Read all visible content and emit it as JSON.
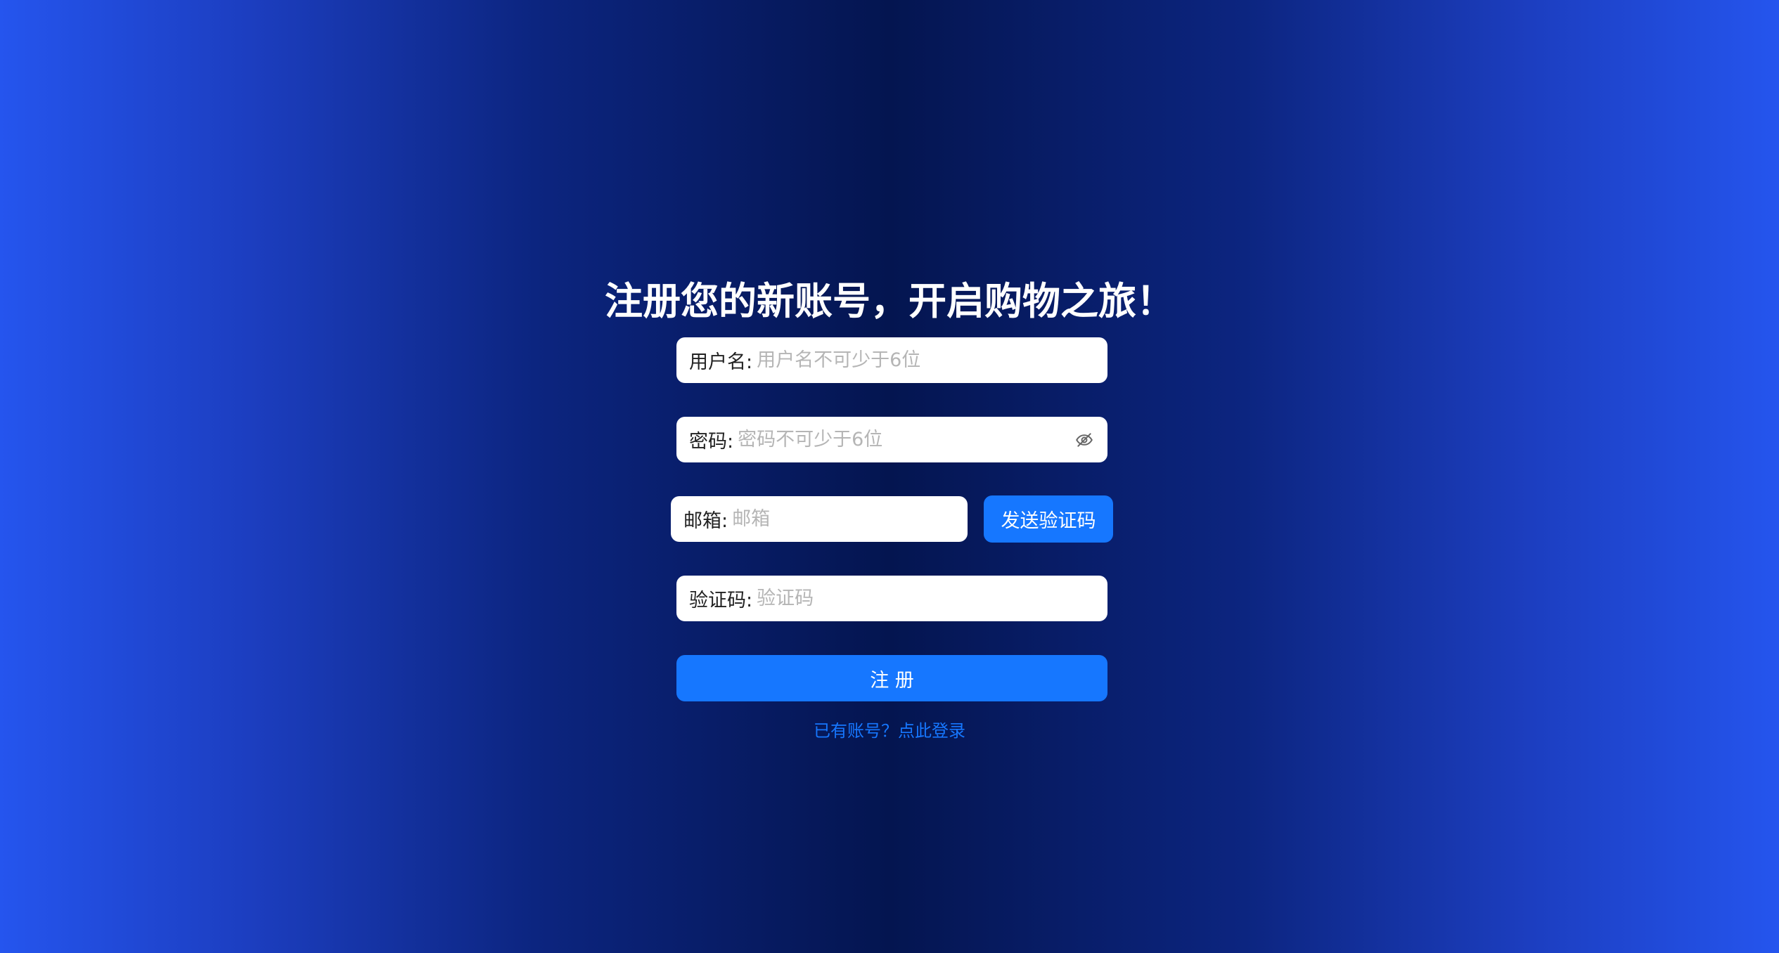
{
  "page": {
    "title": "注册您的新账号，开启购物之旅！"
  },
  "form": {
    "username": {
      "label": "用户名:",
      "placeholder": "用户名不可少于6位",
      "value": ""
    },
    "password": {
      "label": "密码:",
      "placeholder": "密码不可少于6位",
      "value": "",
      "toggle_icon": "eye-invisible-icon"
    },
    "email": {
      "label": "邮箱:",
      "placeholder": "邮箱",
      "value": ""
    },
    "send_code_label": "发送验证码",
    "code": {
      "label": "验证码:",
      "placeholder": "验证码",
      "value": ""
    },
    "submit_label": "注 册",
    "login_link_label": "已有账号？点此登录"
  },
  "colors": {
    "accent": "#1677ff",
    "background_edge": "#2555ee",
    "background_center": "#041550"
  }
}
